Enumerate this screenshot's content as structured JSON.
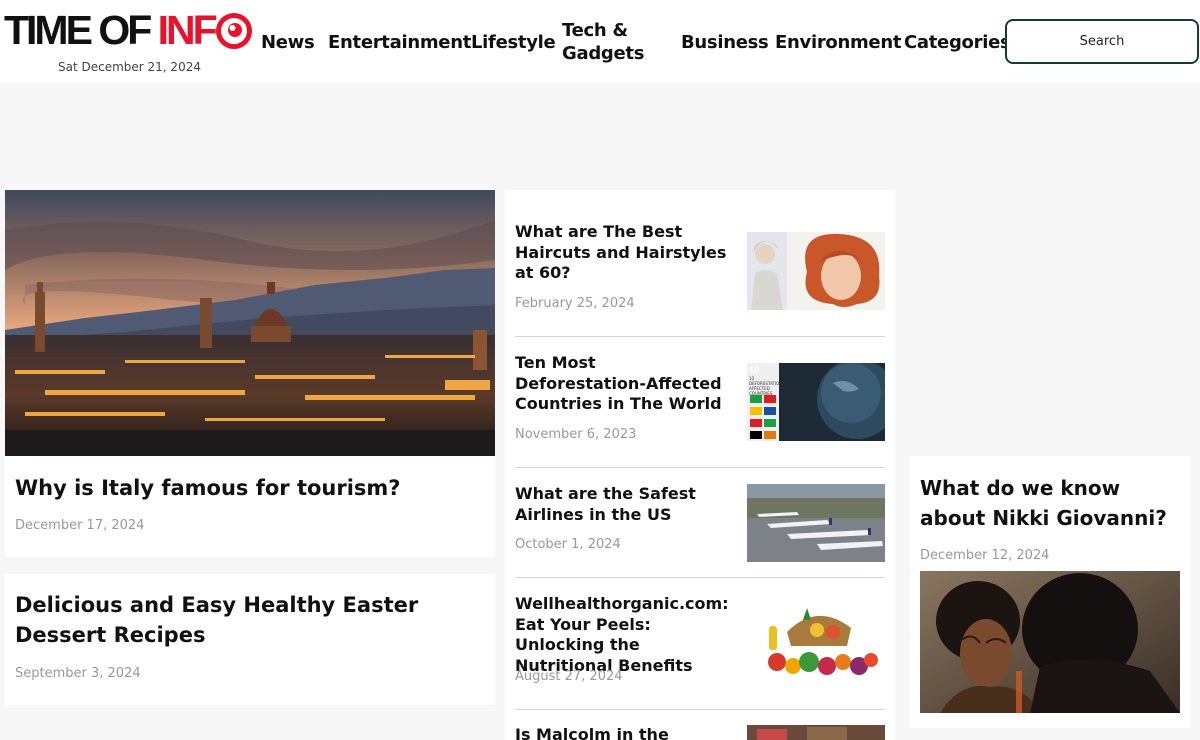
{
  "header": {
    "logo": {
      "part1": "TIME OF ",
      "part2": "INF"
    },
    "date": "Sat December 21, 2024",
    "nav": [
      "News",
      "Entertainment",
      "Lifestyle",
      "Tech &",
      "Gadgets",
      "Business",
      "Environment",
      "Categories"
    ],
    "search_label": "Search"
  },
  "hero": {
    "title": "Why is Italy famous for tourism?",
    "date": "December 17, 2024"
  },
  "easter": {
    "title": "Delicious and Easy Healthy Easter Dessert Recipes",
    "date": "September 3, 2024"
  },
  "list": [
    {
      "title": "What are The Best Haircuts and Hairstyles at 60?",
      "date": "February 25, 2024"
    },
    {
      "title": "Ten Most Deforestation-Affected Countries in The World",
      "date": "November 6, 2023"
    },
    {
      "title": "What are the Safest Airlines in the US",
      "date": "October 1, 2024"
    },
    {
      "title": "Wellhealthorganic.com: Eat Your Peels: Unlocking the Nutritional Benefits",
      "date": "August 27, 2024"
    },
    {
      "title": "Is Malcolm in the Middle",
      "date": ""
    }
  ],
  "thumb_text": {
    "deforestation": "10 DEFORESTATION AFFECTED COUNTRIES"
  },
  "nikki": {
    "title": "What do we know about Nikki Giovanni?",
    "date": "December 12, 2024"
  },
  "colors": {
    "brand_red": "#e8132a",
    "search_border": "#123a40"
  }
}
